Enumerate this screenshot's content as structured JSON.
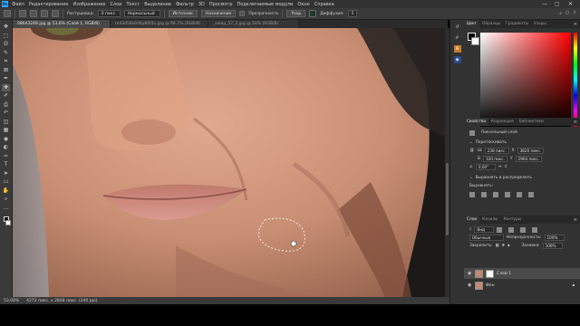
{
  "app": {
    "logo_text": "Ps"
  },
  "menu": {
    "items": [
      "Файл",
      "Редактирование",
      "Изображение",
      "Слои",
      "Текст",
      "Выделение",
      "Фильтр",
      "3D",
      "Просмотр",
      "Подключаемые модули",
      "Окно",
      "Справка"
    ],
    "window_controls": [
      "—",
      "▢",
      "✕"
    ]
  },
  "options": {
    "feather_label": "Растушевка:",
    "feather_value": "0 пикс.",
    "mode_value": "Нормальный",
    "source_btn": "Источник",
    "dest_btn": "Назначение",
    "transparent_label": "Прозрачность",
    "pattern_btn": "Узор",
    "diffusion_label": "Диффузия:",
    "diffusion_value": "5"
  },
  "tabs": [
    {
      "label": "08643249.jpg @ 53,6% (Слой 1, RGB/8)",
      "active": true
    },
    {
      "label": "m43d58s9d6p80f4x.jpg @ 66,7% (RGB/8)",
      "active": false
    },
    {
      "label": "_sleep_57_2.jpg @ 50% (RGB/8)",
      "active": false
    }
  ],
  "toolbar": {
    "icons": [
      "move-icon",
      "marquee-icon",
      "lasso-icon",
      "quick-select-icon",
      "crop-icon",
      "frame-icon",
      "eyedropper-icon",
      "healing-brush-icon",
      "brush-icon",
      "clone-stamp-icon",
      "history-brush-icon",
      "eraser-icon",
      "gradient-icon",
      "blur-icon",
      "dodge-icon",
      "pen-icon",
      "type-icon",
      "path-select-icon",
      "rectangle-icon",
      "hand-icon",
      "zoom-icon",
      "more-tools-icon"
    ],
    "glyphs": [
      "✥",
      "⬚",
      "ʘ",
      "✎",
      "⌗",
      "⊠",
      "✒",
      "✚",
      "✐",
      "⎙",
      "↶",
      "◫",
      "▦",
      "◉",
      "◐",
      "✑",
      "T",
      "➤",
      "▭",
      "✋",
      "⌕",
      "…"
    ],
    "active_index": 7
  },
  "status": {
    "zoom": "53,08%",
    "doc_size": "4272 пикс. x 2848 пикс. (240 ppi)"
  },
  "panels": {
    "color_tabs": [
      "Цвет",
      "Образцы",
      "Градиенты",
      "Узоры"
    ],
    "properties_tabs": [
      "Свойства",
      "Коррекция",
      "Библиотеки"
    ],
    "layer_type": "Пиксельный слой",
    "transform_title": "Перетаскивать",
    "w_label": "Ш",
    "w_value": "238 пикс.",
    "x_label": "X",
    "x_value": "3820 пикс.",
    "h_label": "В",
    "h_value": "320 пикс.",
    "y_label": "Y",
    "y_value": "2964 пикс.",
    "angle_value": "0,00°",
    "align_title": "Выровнять и распределить",
    "align_sub": "Выровнять:",
    "layers_tabs": [
      "Слои",
      "Каналы",
      "Контуры"
    ],
    "filter_value": "Вид",
    "blend_value": "Обычные",
    "opacity_label": "Непрозрачность:",
    "opacity_value": "100%",
    "lock_label": "Закрепить:",
    "fill_label": "Заливка:",
    "fill_value": "100%",
    "layers": [
      {
        "name": "Слой 1",
        "selected": true
      },
      {
        "name": "Фон",
        "selected": false
      }
    ]
  },
  "colors": {
    "ui_bg": "#323232",
    "accent": "#31a8ff",
    "picker_hue": "#ff0000"
  }
}
